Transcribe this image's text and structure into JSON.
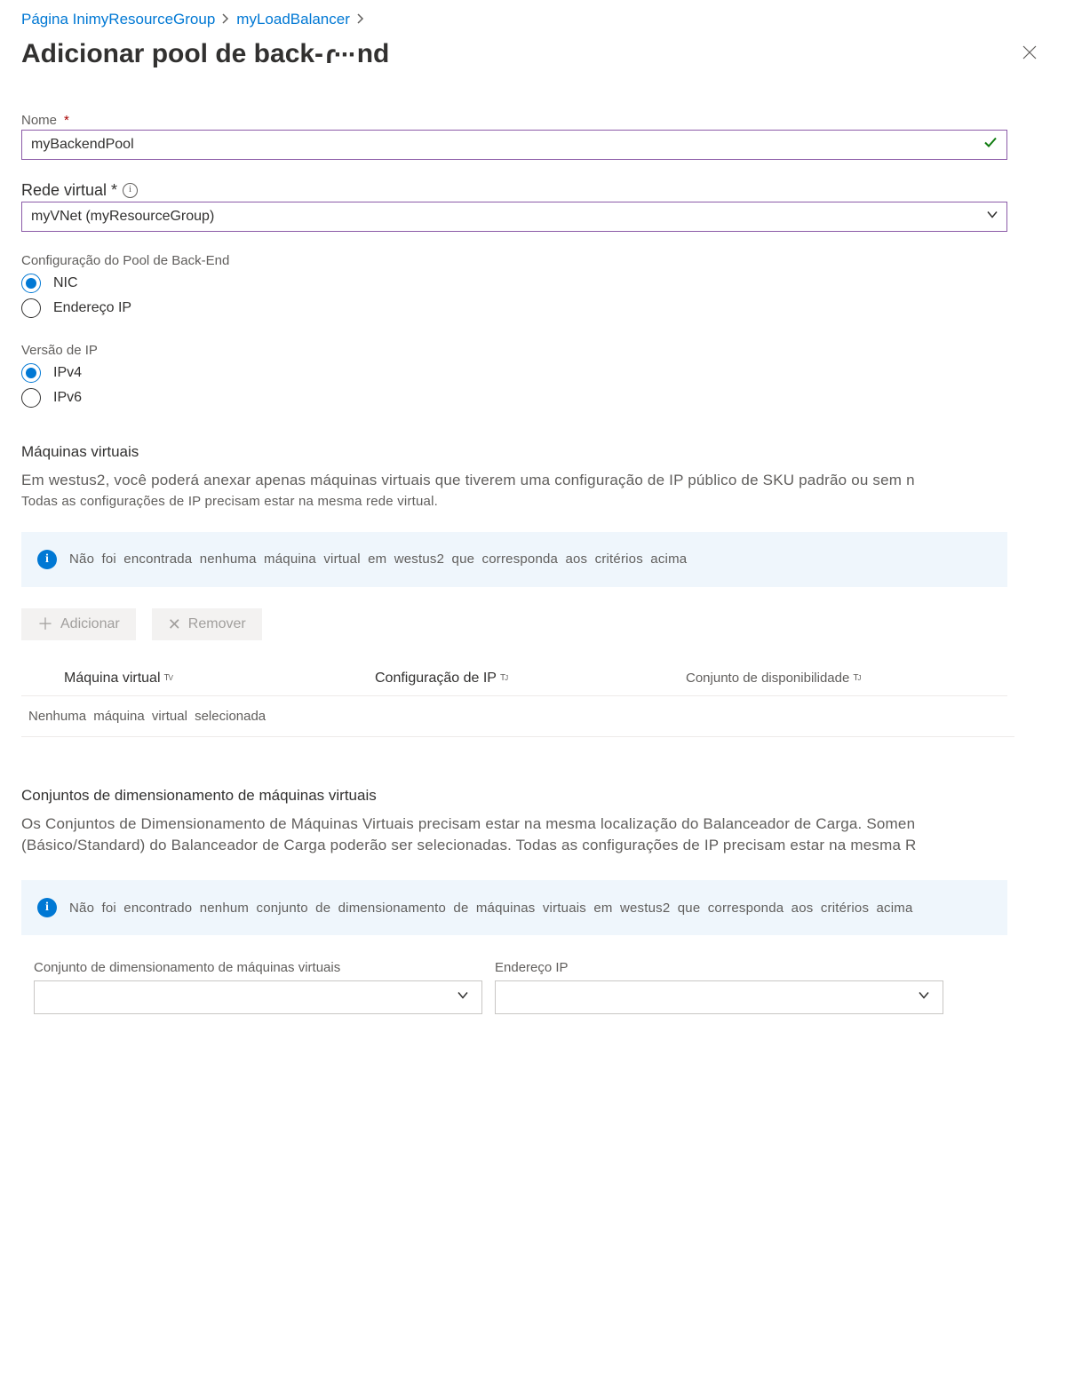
{
  "breadcrumb": {
    "home_prefix": "Página Ini",
    "resource_group": "myResourceGroup",
    "load_balancer": "myLoadBalancer"
  },
  "title_parts": {
    "before": "Adicionar pool de back-",
    "mid_glyph": "⟨···",
    "after": "nd"
  },
  "fields": {
    "name_label": "Nome",
    "name_value": "myBackendPool",
    "vnet_label": "Rede virtual *",
    "vnet_value": "myVNet (myResourceGroup)"
  },
  "pool_config": {
    "label": "Configuração do Pool de Back-End",
    "options": [
      "NIC",
      "Endereço IP"
    ],
    "selected": "NIC"
  },
  "ip_version": {
    "label": "Versão de IP",
    "options": [
      "IPv4",
      "IPv6"
    ],
    "selected": "IPv4"
  },
  "vm_section": {
    "heading": "Máquinas virtuais",
    "desc_line1": "Em westus2, você poderá anexar apenas máquinas virtuais que tiverem uma configuração de IP público de SKU padrão ou sem n",
    "desc_line2": "Todas as configurações de IP precisam estar na mesma rede virtual.",
    "banner": "Não foi encontrada nenhuma máquina virtual em westus2 que corresponda aos critérios acima",
    "add_btn": "Adicionar",
    "remove_btn": "Remover",
    "col1": "Máquina virtual",
    "col2": "Configuração de IP",
    "col3": "Conjunto de disponibilidade",
    "sort_glyph": "T",
    "empty_row": "Nenhuma máquina virtual selecionada"
  },
  "scaleset_section": {
    "heading": "Conjuntos de dimensionamento de máquinas virtuais",
    "desc_line1": "Os Conjuntos de Dimensionamento de Máquinas Virtuais precisam estar na mesma localização do Balanceador de Carga. Somen",
    "desc_line2": "(Básico/Standard) do Balanceador de Carga poderão ser selecionadas. Todas as configurações de IP precisam estar na mesma R",
    "banner": "Não foi encontrado nenhum conjunto de dimensionamento de máquinas virtuais em westus2 que corresponda aos critérios acima",
    "col1_label": "Conjunto de dimensionamento de máquinas virtuais",
    "col2_label": "Endereço IP"
  }
}
